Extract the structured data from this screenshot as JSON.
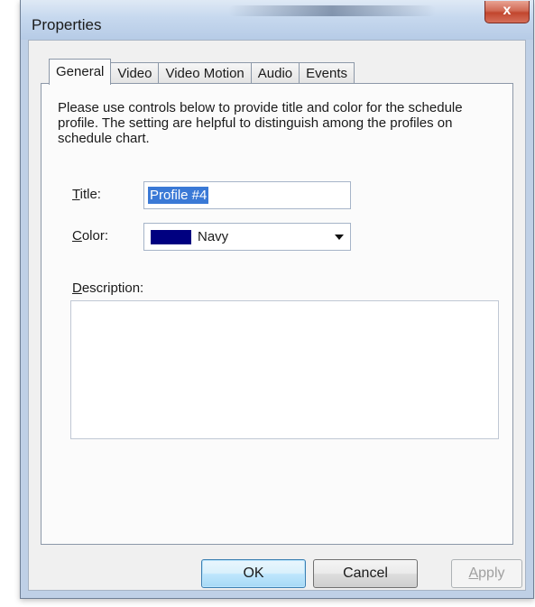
{
  "window": {
    "title": "Properties",
    "close_label": "x"
  },
  "tabs": [
    {
      "label": "General",
      "active": true
    },
    {
      "label": "Video",
      "active": false
    },
    {
      "label": "Video Motion",
      "active": false
    },
    {
      "label": "Audio",
      "active": false
    },
    {
      "label": "Events",
      "active": false
    }
  ],
  "general": {
    "instructions": "Please use controls below to provide title and color for the schedule profile. The setting are helpful to distinguish among the profiles on schedule chart.",
    "title_label": "Title:",
    "title_value": "Profile #4",
    "color_label": "Color:",
    "color_value": "Navy",
    "color_swatch": "#000080",
    "description_label": "Description:",
    "description_value": ""
  },
  "buttons": {
    "ok": "OK",
    "cancel": "Cancel",
    "apply": "Apply"
  }
}
